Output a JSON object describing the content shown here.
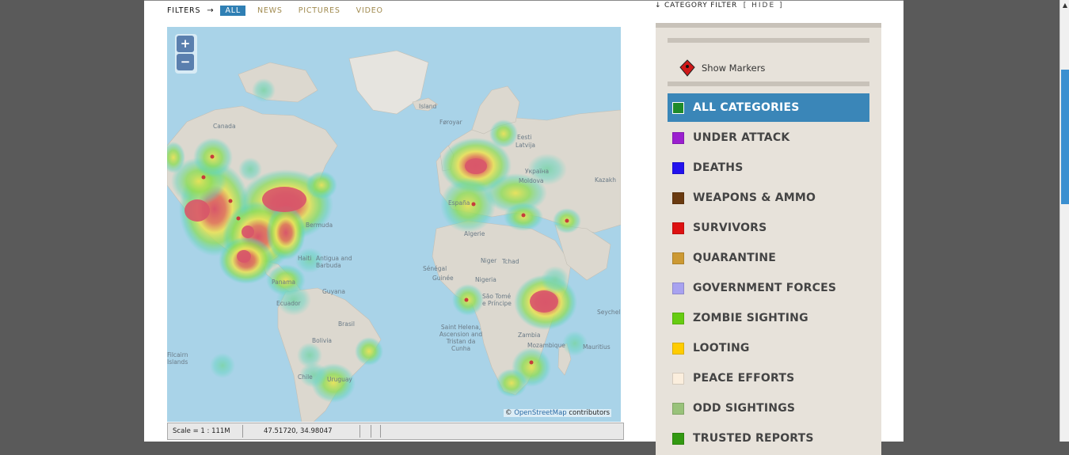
{
  "filters": {
    "label": "FILTERS",
    "arrow": "→",
    "items": [
      "ALL",
      "NEWS",
      "PICTURES",
      "VIDEO"
    ],
    "active_index": 0
  },
  "map": {
    "zoom_in": "+",
    "zoom_out": "−",
    "attribution_symbol": "©",
    "attribution_link": "OpenStreetMap",
    "attribution_suffix": "contributors",
    "labels": [
      "Canada",
      "Island",
      "Føroyar",
      "Eesti",
      "Latvija",
      "Україна",
      "Moldova",
      "Kazakh",
      "España",
      "Algerie",
      "Bermuda",
      "Haiti",
      "Antigua and Barbuda",
      "Guyana",
      "Sénégal",
      "Guinée",
      "Niger",
      "Tchad",
      "Nigeria",
      "São Tomé e Príncipe",
      "Brasil",
      "Bolivia",
      "Saint Helena, Ascension and Tristan da Cunha",
      "Zambia",
      "Mozambique",
      "Seychelles",
      "Mauritius",
      "Chile",
      "Uruguay",
      "Filcairn Islands",
      "Ecuador",
      "Panama"
    ]
  },
  "status": {
    "scale": "Scale = 1 : 111M",
    "coords": "47.51720, 34.98047"
  },
  "category_filter": {
    "arrow": "↓",
    "title": "CATEGORY FILTER",
    "hide": "[ HIDE ]",
    "show_markers": "Show Markers",
    "categories": [
      {
        "name": "ALL CATEGORIES",
        "color": "#1e8a2a"
      },
      {
        "name": "UNDER ATTACK",
        "color": "#9b1fcf"
      },
      {
        "name": "DEATHS",
        "color": "#2211ee"
      },
      {
        "name": "WEAPONS & AMMO",
        "color": "#6a3a10"
      },
      {
        "name": "SURVIVORS",
        "color": "#dd1111"
      },
      {
        "name": "QUARANTINE",
        "color": "#cc9933"
      },
      {
        "name": "GOVERNMENT FORCES",
        "color": "#a8a2f0"
      },
      {
        "name": "ZOMBIE SIGHTING",
        "color": "#66cc11"
      },
      {
        "name": "LOOTING",
        "color": "#ffcc00"
      },
      {
        "name": "PEACE EFFORTS",
        "color": "#fbeedd"
      },
      {
        "name": "ODD SIGHTINGS",
        "color": "#99c27a"
      },
      {
        "name": "TRUSTED REPORTS",
        "color": "#339911"
      }
    ],
    "active_index": 0
  }
}
